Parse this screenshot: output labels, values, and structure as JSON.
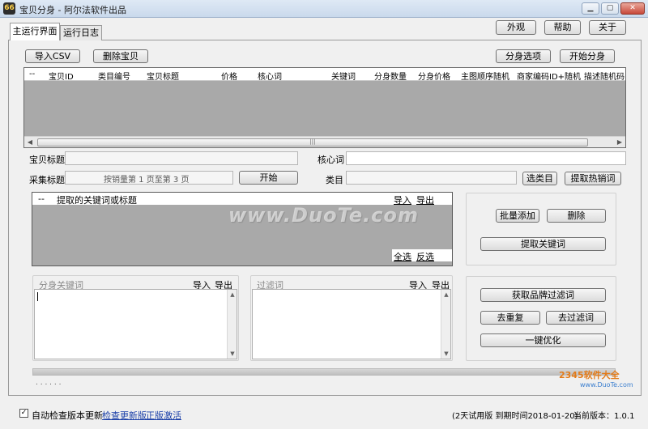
{
  "window": {
    "title": "宝贝分身 - 阿尔法软件出品",
    "icon_text": "66",
    "controls": [
      "minimize",
      "restore",
      "close"
    ]
  },
  "tabs": [
    {
      "label": "主运行界面",
      "active": true
    },
    {
      "label": "运行日志",
      "active": false
    }
  ],
  "top_buttons": {
    "appearance": "外观",
    "help": "帮助",
    "about": "关于"
  },
  "toolbar": {
    "import_csv": "导入CSV",
    "delete_item": "删除宝贝",
    "clone_options": "分身选项",
    "start_clone": "开始分身"
  },
  "grid": {
    "columns": [
      "--",
      "宝贝ID",
      "类目编号",
      "宝贝标题",
      "价格",
      "核心词",
      "关键词",
      "分身数量",
      "分身价格",
      "主图顺序随机",
      "商家编码ID+随机",
      "描述随机码"
    ]
  },
  "form": {
    "item_title_label": "宝贝标题",
    "core_word_label": "核心词",
    "collect_title_label": "采集标题",
    "collect_range": "按销量第  1  页至第  3  页",
    "start_button": "开始",
    "category_label": "类目",
    "select_category_button": "选类目",
    "extract_hot_words_button": "提取热销词"
  },
  "keyword_panel": {
    "dash": "--",
    "header": "提取的关键词或标题",
    "import": "导入",
    "export": "导出",
    "select_all": "全选",
    "invert": "反选"
  },
  "keyword_actions": {
    "batch_add": "批量添加",
    "delete": "删除",
    "extract_keywords": "提取关键词"
  },
  "clone_keywords": {
    "label": "分身关键词",
    "import": "导入",
    "export": "导出"
  },
  "filter_words": {
    "label": "过滤词",
    "import": "导入",
    "export": "导出"
  },
  "filter_actions": {
    "get_brand_filter": "获取品牌过滤词",
    "dedupe": "去重复",
    "remove_filter": "去过滤词",
    "optimize": "一键优化"
  },
  "progress": {
    "dots": ". . . . . ."
  },
  "status": {
    "auto_check_label": "自动检查版本更新",
    "auto_check_checked": true,
    "check_update_link": "检查更新版",
    "activate_link": "正版激活",
    "trial_text": "(2天试用版 到期时间2018-01-20)",
    "version_text": "当前版本：1.0.1"
  },
  "watermark": {
    "text": "www.DuoTe.com",
    "corner_brand": "2345软件大全",
    "corner_url": "www.DuoTe.com"
  }
}
